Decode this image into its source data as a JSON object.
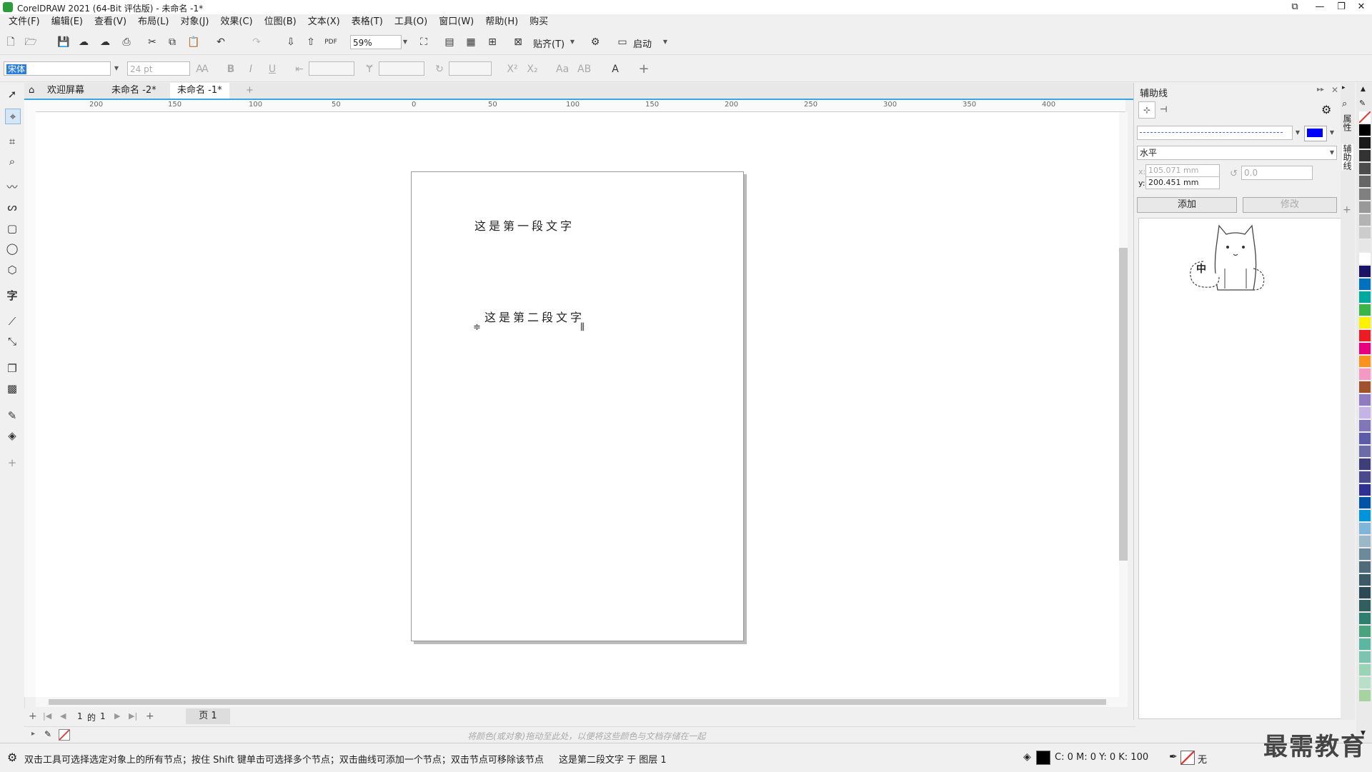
{
  "window": {
    "title": "CorelDRAW 2021 (64-Bit 评估版) - 未命名 -1*"
  },
  "menu": [
    "文件(F)",
    "编辑(E)",
    "查看(V)",
    "布局(L)",
    "对象(J)",
    "效果(C)",
    "位图(B)",
    "文本(X)",
    "表格(T)",
    "工具(O)",
    "窗口(W)",
    "帮助(H)",
    "购买"
  ],
  "toolbar": {
    "zoom": "59%",
    "snap_label": "贴齐(T)",
    "launch_label": "启动"
  },
  "propbar": {
    "font": "宋体",
    "size": "24 pt",
    "bold": "B",
    "italic": "I",
    "underline": "U",
    "superscript": "X²",
    "subscript": "X₂",
    "char_a": "A"
  },
  "tabs": [
    "欢迎屏幕",
    "未命名 -2*",
    "未命名 -1*"
  ],
  "ruler": {
    "h_labels": [
      "200",
      "150",
      "100",
      "50",
      "0",
      "50",
      "100",
      "150",
      "200",
      "250",
      "300",
      "350",
      "400"
    ]
  },
  "page": {
    "text1": "这是第一段文字",
    "text2": "这是第二段文字"
  },
  "pagenav": {
    "current": "1",
    "of": "的",
    "total": "1",
    "page_tab": "页 1"
  },
  "color_hint": "将颜色(或对象)拖动至此处，以便将这些颜色与文档存储在一起",
  "status": {
    "hint": "双击工具可选择选定对象上的所有节点；按住 Shift 键单击可选择多个节点；双击曲线可添加一个节点；双击节点可移除该节点",
    "object": "这是第二段文字 于 图层 1",
    "cmyk": "C: 0 M: 0 Y: 0 K: 100",
    "outline": "无"
  },
  "docker": {
    "title": "辅助线",
    "orientation": "水平",
    "x_value": "105.071 mm",
    "y_value": "200.451 mm",
    "angle": "0.0",
    "x_label": "x:",
    "y_label": "y:",
    "add_button": "添加",
    "modify_button": "修改",
    "line_color": "#0000ff",
    "doodle_text": "中"
  },
  "side_tabs": [
    "属性",
    "辅助线"
  ],
  "palette": [
    "#ffffff",
    "#000000",
    "#1a1a1a",
    "#333333",
    "#4d4d4d",
    "#666666",
    "#808080",
    "#999999",
    "#b3b3b3",
    "#cccccc",
    "#e6e6e6",
    "#ffffff",
    "#1b1464",
    "#0071bc",
    "#00a99d",
    "#39b54a",
    "#fff200",
    "#ed1c24",
    "#e6007e",
    "#f7931e",
    "#f49ac2",
    "#a0522d",
    "#8e7cc3",
    "#c5b3e6",
    "#7f77b8",
    "#5c5ba8",
    "#6d6aa8",
    "#3f3d7a",
    "#4a4a8c",
    "#2e3192",
    "#0054a6",
    "#0095da",
    "#7fb5d8",
    "#9bb8c9",
    "#6c8a99",
    "#4f6b7a",
    "#3c5a66",
    "#2a4a55",
    "#315f5f",
    "#2e7f6f",
    "#4aa37f",
    "#5bb7a0",
    "#7dc4b0",
    "#9ad3b6",
    "#b7e0c9",
    "#a7d3a0"
  ],
  "watermark": "最需教育"
}
